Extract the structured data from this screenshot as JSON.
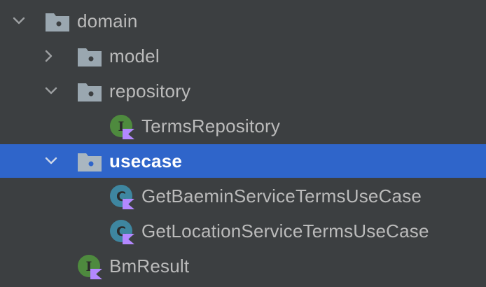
{
  "tree": {
    "items": [
      {
        "label": "domain",
        "type": "package",
        "expanded": true,
        "icon": "package-folder-icon"
      },
      {
        "label": "model",
        "type": "package",
        "expanded": false,
        "icon": "package-folder-icon"
      },
      {
        "label": "repository",
        "type": "package",
        "expanded": true,
        "icon": "package-folder-icon"
      },
      {
        "label": "TermsRepository",
        "type": "interface",
        "icon": "kotlin-interface-icon"
      },
      {
        "label": "usecase",
        "type": "package",
        "expanded": true,
        "selected": true,
        "icon": "package-folder-icon"
      },
      {
        "label": "GetBaeminServiceTermsUseCase",
        "type": "class",
        "icon": "kotlin-class-icon"
      },
      {
        "label": "GetLocationServiceTermsUseCase",
        "type": "class",
        "icon": "kotlin-class-icon"
      },
      {
        "label": "BmResult",
        "type": "interface",
        "icon": "kotlin-interface-icon"
      }
    ]
  },
  "colors": {
    "background": "#3c3f41",
    "selection": "#2f65ca",
    "text": "#bbbbbb",
    "selected_text": "#ffffff",
    "folder": "#9aa7b0",
    "interface_badge": "#4e8a3e",
    "class_badge": "#3e86a0",
    "kotlin_marker": "#b388ff"
  }
}
